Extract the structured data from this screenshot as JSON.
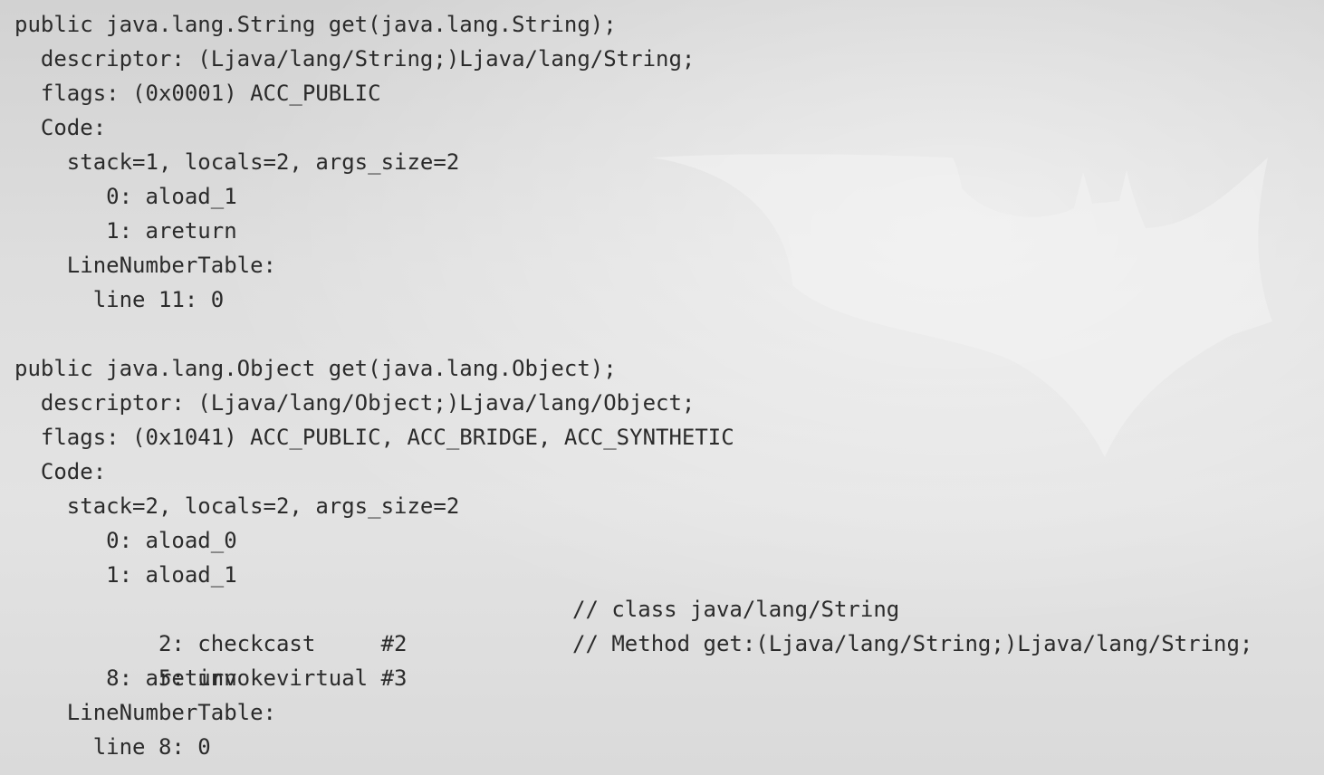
{
  "background": {
    "watermark_icon": "bat-logo-icon",
    "colors": {
      "background": "#dcdcdc",
      "text": "#2b2b2b",
      "watermark": "#f4f4f4"
    }
  },
  "code": {
    "lines": [
      {
        "text": "public java.lang.String get(java.lang.String);"
      },
      {
        "text": "  descriptor: (Ljava/lang/String;)Ljava/lang/String;"
      },
      {
        "text": "  flags: (0x0001) ACC_PUBLIC"
      },
      {
        "text": "  Code:"
      },
      {
        "text": "    stack=1, locals=2, args_size=2"
      },
      {
        "text": "       0: aload_1"
      },
      {
        "text": "       1: areturn"
      },
      {
        "text": "    LineNumberTable:"
      },
      {
        "text": "      line 11: 0"
      },
      {
        "text": ""
      },
      {
        "text": "public java.lang.Object get(java.lang.Object);"
      },
      {
        "text": "  descriptor: (Ljava/lang/Object;)Ljava/lang/Object;"
      },
      {
        "text": "  flags: (0x1041) ACC_PUBLIC, ACC_BRIDGE, ACC_SYNTHETIC"
      },
      {
        "text": "  Code:"
      },
      {
        "text": "    stack=2, locals=2, args_size=2"
      },
      {
        "text": "       0: aload_0"
      },
      {
        "text": "       1: aload_1"
      },
      {
        "text": "       2: checkcast     #2",
        "comment": "// class java/lang/String"
      },
      {
        "text": "       5: invokevirtual #3",
        "comment": "// Method get:(Ljava/lang/String;)Ljava/lang/String;"
      },
      {
        "text": "       8: areturn"
      },
      {
        "text": "    LineNumberTable:"
      },
      {
        "text": "      line 8: 0"
      }
    ]
  }
}
